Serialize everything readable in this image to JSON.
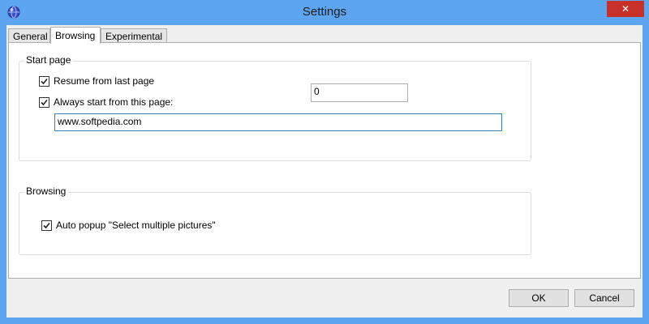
{
  "window": {
    "title": "Settings",
    "close_glyph": "✕",
    "title_color": "#5da5ef",
    "close_color": "#c7312a"
  },
  "tabs": [
    {
      "label": "General",
      "active": false
    },
    {
      "label": "Browsing",
      "active": true
    },
    {
      "label": "Experimental",
      "active": false
    }
  ],
  "start_page": {
    "group_title": "Start page",
    "resume_label": "Resume from last page",
    "resume_checked": true,
    "always_label": "Always start from this page:",
    "always_checked": true,
    "url_value": "www.softpedia.com",
    "number_value": "0"
  },
  "browsing": {
    "group_title": "Browsing",
    "auto_popup_label": "Auto popup \"Select multiple pictures\"",
    "auto_popup_checked": true
  },
  "footer": {
    "ok_label": "OK",
    "cancel_label": "Cancel"
  }
}
